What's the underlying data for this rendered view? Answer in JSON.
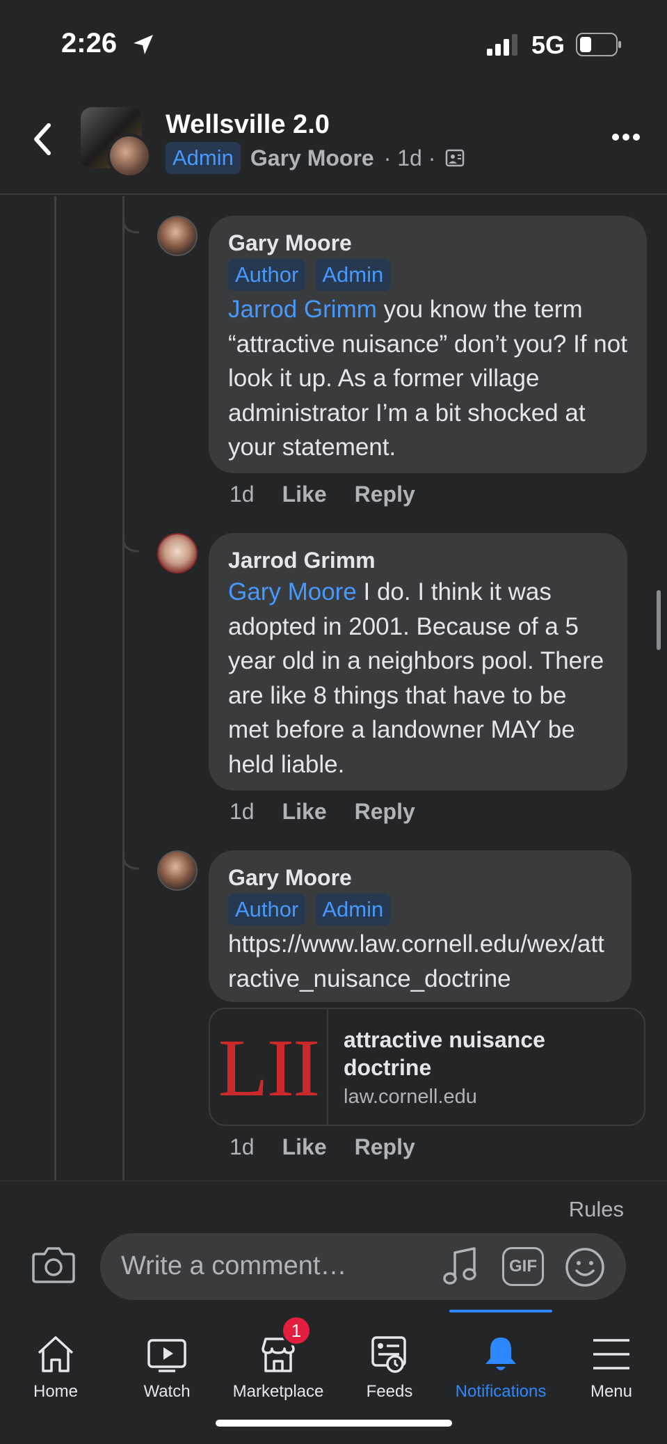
{
  "status_bar": {
    "time": "2:26",
    "network": "5G"
  },
  "header": {
    "title": "Wellsville 2.0",
    "admin_badge": "Admin",
    "author": "Gary Moore",
    "meta": "· 1d ·"
  },
  "comments": [
    {
      "name": "Gary Moore",
      "badges": [
        "Author",
        "Admin"
      ],
      "mention": "Jarrod Grimm",
      "text": " you know the term “attractive nuisance” don’t you? If not look it up. As a former village administrator I’m a bit shocked at your statement.",
      "age": "1d",
      "like": "Like",
      "reply": "Reply"
    },
    {
      "name": "Jarrod Grimm",
      "mention": "Gary Moore",
      "text": " I do. I think it was adopted in 2001. Because of a 5 year old in a neighbors pool. There are like 8 things that have to be met before a landowner MAY be held liable.",
      "age": "1d",
      "like": "Like",
      "reply": "Reply"
    },
    {
      "name": "Gary Moore",
      "badges": [
        "Author",
        "Admin"
      ],
      "link": "https://www.law.cornell.edu/wex/attractive_nuisance_doctrine",
      "age": "1d",
      "like": "Like",
      "reply": "Reply"
    }
  ],
  "link_preview": {
    "logo_text": "LII",
    "title": "attractive nuisance doctrine",
    "domain": "law.cornell.edu"
  },
  "composer": {
    "rules": "Rules",
    "placeholder": "Write a comment…",
    "gif_label": "GIF"
  },
  "tabs": [
    {
      "label": "Home",
      "icon": "home-icon"
    },
    {
      "label": "Watch",
      "icon": "watch-icon"
    },
    {
      "label": "Marketplace",
      "icon": "marketplace-icon",
      "badge": "1"
    },
    {
      "label": "Feeds",
      "icon": "feeds-icon"
    },
    {
      "label": "Notifications",
      "icon": "bell-icon",
      "active": true
    },
    {
      "label": "Menu",
      "icon": "menu-icon"
    }
  ],
  "colors": {
    "accent": "#2d88ff",
    "link": "#4599ff",
    "badge_bg": "#263951",
    "bubble": "#3a3b3c",
    "background": "#242526",
    "notification": "#e41e3f"
  }
}
